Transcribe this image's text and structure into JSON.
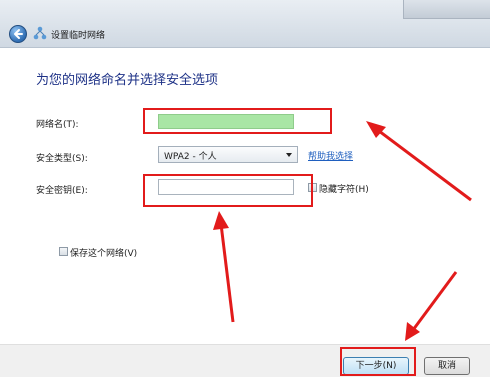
{
  "window": {
    "title": "设置临时网络"
  },
  "page": {
    "heading": "为您的网络命名并选择安全选项"
  },
  "form": {
    "network_name_label": "网络名(T):",
    "network_name_value": "",
    "security_type_label": "安全类型(S):",
    "security_type_value": "WPA2 - 个人",
    "help_link": "帮助我选择",
    "security_key_label": "安全密钥(E):",
    "security_key_value": "",
    "hide_chars_label": "隐藏字符(H)",
    "save_network_label": "保存这个网络(V)"
  },
  "footer": {
    "next_label": "下一步(N)",
    "cancel_label": "取消"
  },
  "colors": {
    "highlight": "#e21b1b",
    "name_field_fill": "#a9e6a5",
    "link": "#1f5fbf",
    "heading": "#1e3287"
  },
  "icons": [
    "back-arrow-icon",
    "network-icon",
    "dropdown-arrow-icon"
  ]
}
